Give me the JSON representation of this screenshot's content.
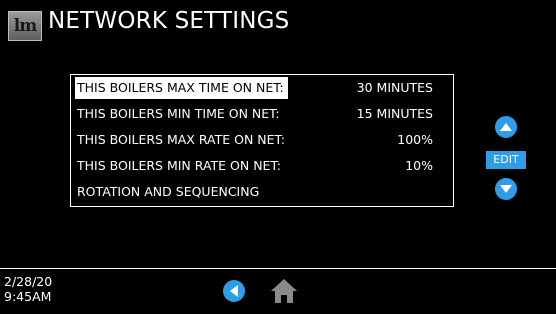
{
  "header": {
    "title": "NETWORK SETTINGS",
    "logo_icon": "boiler-brand-logo"
  },
  "settings": [
    {
      "label": "THIS BOILERS MAX TIME ON NET:",
      "value": "30 MINUTES",
      "selected": true
    },
    {
      "label": "THIS BOILERS MIN TIME ON NET:",
      "value": "15 MINUTES",
      "selected": false
    },
    {
      "label": "THIS BOILERS MAX RATE ON NET:",
      "value": "100%",
      "selected": false
    },
    {
      "label": "THIS BOILERS MIN RATE ON NET:",
      "value": "10%",
      "selected": false
    },
    {
      "label": "ROTATION AND SEQUENCING",
      "value": "",
      "selected": false
    }
  ],
  "controls": {
    "edit_label": "EDIT",
    "up_icon": "chevron-up-icon",
    "down_icon": "chevron-down-icon"
  },
  "footer": {
    "date": "2/28/20",
    "time": "9:45AM",
    "back_icon": "chevron-left-icon",
    "home_icon": "home-icon"
  },
  "colors": {
    "accent": "#2f9ee6",
    "background": "#000000",
    "text": "#ffffff"
  }
}
